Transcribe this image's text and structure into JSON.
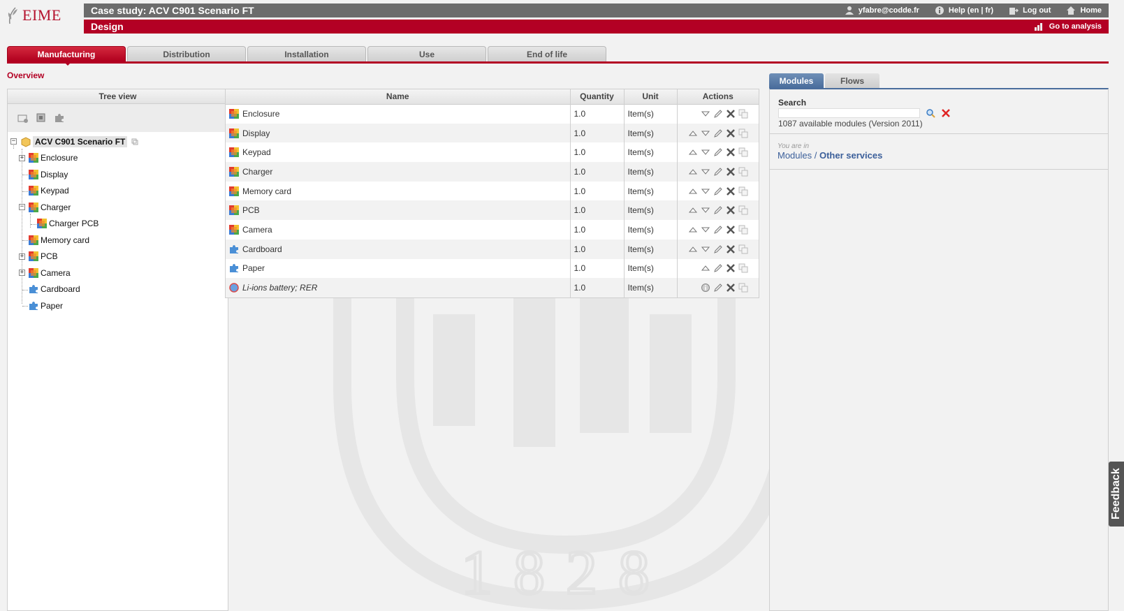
{
  "app": {
    "logo_text": "EIME"
  },
  "header": {
    "title": "Case study: ACV C901 Scenario FT",
    "subtitle": "Design",
    "user": "yfabre@codde.fr",
    "help": "Help (en | fr)",
    "logout": "Log out",
    "home": "Home",
    "analysis": "Go to analysis"
  },
  "tabs": [
    {
      "label": "Manufacturing",
      "active": true
    },
    {
      "label": "Distribution",
      "active": false
    },
    {
      "label": "Installation",
      "active": false
    },
    {
      "label": "Use",
      "active": false
    },
    {
      "label": "End of life",
      "active": false
    }
  ],
  "overview_label": "Overview",
  "tree": {
    "header": "Tree view",
    "root": "ACV C901 Scenario FT",
    "nodes": [
      {
        "label": "Enclosure",
        "icon": "module-icon",
        "expandable": true
      },
      {
        "label": "Display",
        "icon": "module-icon",
        "expandable": false
      },
      {
        "label": "Keypad",
        "icon": "module-icon",
        "expandable": false
      },
      {
        "label": "Charger",
        "icon": "module-icon",
        "expandable": true,
        "expanded": true
      },
      {
        "label": "Charger PCB",
        "icon": "module-icon",
        "child": true
      },
      {
        "label": "Memory card",
        "icon": "module-icon",
        "expandable": false
      },
      {
        "label": "PCB",
        "icon": "module-icon",
        "expandable": true
      },
      {
        "label": "Camera",
        "icon": "module-icon",
        "expandable": true
      },
      {
        "label": "Cardboard",
        "icon": "puzzle-icon",
        "expandable": false
      },
      {
        "label": "Paper",
        "icon": "puzzle-icon",
        "expandable": false
      }
    ]
  },
  "table": {
    "headers": {
      "name": "Name",
      "quantity": "Quantity",
      "unit": "Unit",
      "actions": "Actions"
    },
    "rows": [
      {
        "name": "Enclosure",
        "quantity": "1.0",
        "unit": "Item(s)",
        "icon": "module-icon",
        "up": false,
        "down": true
      },
      {
        "name": "Display",
        "quantity": "1.0",
        "unit": "Item(s)",
        "icon": "module-icon",
        "up": true,
        "down": true
      },
      {
        "name": "Keypad",
        "quantity": "1.0",
        "unit": "Item(s)",
        "icon": "module-icon",
        "up": true,
        "down": true
      },
      {
        "name": "Charger",
        "quantity": "1.0",
        "unit": "Item(s)",
        "icon": "module-icon",
        "up": true,
        "down": true
      },
      {
        "name": "Memory card",
        "quantity": "1.0",
        "unit": "Item(s)",
        "icon": "module-icon",
        "up": true,
        "down": true
      },
      {
        "name": "PCB",
        "quantity": "1.0",
        "unit": "Item(s)",
        "icon": "module-icon",
        "up": true,
        "down": true
      },
      {
        "name": "Camera",
        "quantity": "1.0",
        "unit": "Item(s)",
        "icon": "module-icon",
        "up": true,
        "down": true
      },
      {
        "name": "Cardboard",
        "quantity": "1.0",
        "unit": "Item(s)",
        "icon": "puzzle-icon",
        "up": true,
        "down": true
      },
      {
        "name": "Paper",
        "quantity": "1.0",
        "unit": "Item(s)",
        "icon": "puzzle-icon",
        "up": true,
        "down": false
      },
      {
        "name": "Li-ions battery; RER",
        "quantity": "1.0",
        "unit": "Item(s)",
        "icon": "flow-icon",
        "italic": true,
        "info": true
      }
    ]
  },
  "right": {
    "tabs": [
      {
        "label": "Modules",
        "active": true
      },
      {
        "label": "Flows",
        "active": false
      }
    ],
    "search_label": "Search",
    "search_value": "",
    "available": "1087 available modules (Version 2011)",
    "you_are_in": "You are in",
    "crumb_root": "Modules",
    "crumb_sep": " / ",
    "crumb_current": "Other services"
  },
  "feedback": "Feedback",
  "watermark_year": "1828",
  "colors": {
    "brand_red": "#b30024",
    "header_gray": "#6c6c6c",
    "accent_blue": "#4a6d9c"
  }
}
